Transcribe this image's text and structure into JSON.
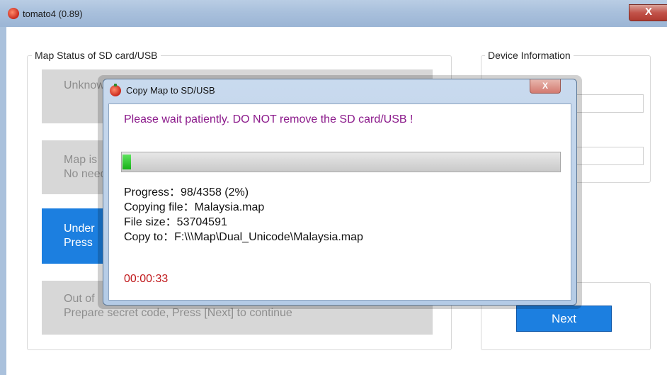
{
  "window": {
    "title": "tomato4 (0.89)",
    "close_label": "X"
  },
  "map_status": {
    "title": "Map Status of SD card/USB",
    "items": [
      {
        "line1": "Unknown"
      },
      {
        "line1": "Map is",
        "line2": "No need"
      },
      {
        "line1": "Under",
        "line2": "Press"
      },
      {
        "line1": "Out of",
        "line2": "Prepare secret code, Press [Next] to continue"
      }
    ],
    "active_index": 2
  },
  "device_info": {
    "title": "Device Information"
  },
  "next_button": {
    "label": "Next"
  },
  "dialog": {
    "title": "Copy Map to SD/USB",
    "close_label": "X",
    "message": "Please wait patiently. DO NOT remove the SD card/USB !",
    "progress_fraction": 0.02,
    "progress_text": "Progress：98/4358  (2%)",
    "copying_text": "Copying file：Malaysia.map",
    "file_size_text": "File size：53704591",
    "copy_to_text": "Copy to：F:\\\\\\Map\\Dual_Unicode\\Malaysia.map",
    "elapsed": "00:00:33"
  },
  "colors": {
    "accent_blue": "#1c7fe0",
    "message_purple": "#8b1a8b",
    "timer_red": "#c0181b",
    "progress_green": "#17b117"
  }
}
